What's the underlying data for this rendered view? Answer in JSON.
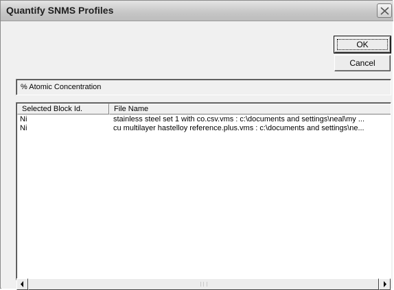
{
  "window": {
    "title": "Quantify SNMS Profiles"
  },
  "buttons": {
    "ok_label": "OK",
    "cancel_label": "Cancel"
  },
  "quantity_field": {
    "value": "% Atomic Concentration"
  },
  "list": {
    "columns": [
      "Selected Block Id.",
      "File Name"
    ],
    "rows": [
      [
        "Ni",
        "stainless steel set 1 with co.csv.vms : c:\\documents and settings\\neal\\my ..."
      ],
      [
        "Ni",
        "cu multilayer hastelloy reference.plus.vms : c:\\documents and settings\\ne..."
      ]
    ]
  },
  "icons": {
    "close": "close-icon",
    "scroll_left": "arrow-left-icon",
    "scroll_right": "arrow-right-icon"
  }
}
